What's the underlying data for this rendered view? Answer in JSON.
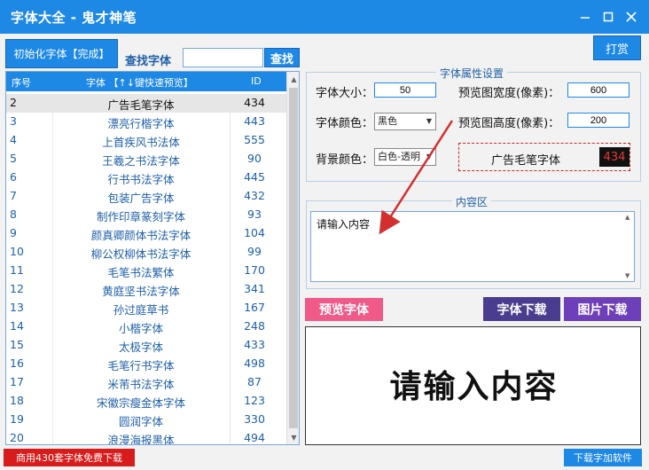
{
  "window": {
    "title": "字体大全 - 鬼才神笔"
  },
  "toolbar": {
    "init_label": "初始化字体【完成】",
    "search_label": "查找字体",
    "search_value": "",
    "search_button": "查找",
    "reward_button": "打赏"
  },
  "font_table": {
    "headers": [
      "序号",
      "字体 【↑↓键快速预览】",
      "ID"
    ],
    "rows": [
      [
        "2",
        "广告毛笔字体",
        "434"
      ],
      [
        "3",
        "漂亮行楷字体",
        "443"
      ],
      [
        "4",
        "上首疾风书法体",
        "555"
      ],
      [
        "5",
        "王羲之书法字体",
        "90"
      ],
      [
        "6",
        "行书书法字体",
        "445"
      ],
      [
        "7",
        "包装广告字体",
        "432"
      ],
      [
        "8",
        "制作印章篆刻字体",
        "93"
      ],
      [
        "9",
        "颜真卿颜体书法字体",
        "104"
      ],
      [
        "10",
        "柳公权柳体书法字体",
        "99"
      ],
      [
        "11",
        "毛笔书法繁体",
        "170"
      ],
      [
        "12",
        "黄庭坚书法字体",
        "341"
      ],
      [
        "13",
        "孙过庭草书",
        "167"
      ],
      [
        "14",
        "小楷字体",
        "248"
      ],
      [
        "15",
        "太极字体",
        "433"
      ],
      [
        "16",
        "毛笔行书字体",
        "498"
      ],
      [
        "17",
        "米芾书法字体",
        "87"
      ],
      [
        "18",
        "宋徽宗瘦金体字体",
        "123"
      ],
      [
        "19",
        "圆润字体",
        "330"
      ],
      [
        "20",
        "浪漫海报黑体",
        "494"
      ]
    ],
    "selected_index": 0
  },
  "properties": {
    "group_title": "字体属性设置",
    "font_size_label": "字体大小：",
    "font_size_value": "50",
    "font_color_label": "字体颜色：",
    "font_color_value": "黑色",
    "bg_color_label": "背景颜色：",
    "bg_color_value": "白色-透明",
    "width_label": "预览图宽度(像素)：",
    "width_value": "600",
    "height_label": "预览图高度(像素)：",
    "height_value": "200",
    "preview_name": "广告毛笔字体",
    "preview_id": "434"
  },
  "content": {
    "group_title": "内容区",
    "text": "请输入内容"
  },
  "actions": {
    "preview_button": "预览字体",
    "font_download_button": "字体下载",
    "image_download_button": "图片下载"
  },
  "preview": {
    "text": "请输入内容"
  },
  "footer": {
    "promo_button": "商用430套字体免费下载",
    "download_button": "下载字加软件"
  },
  "colors": {
    "accent": "#1e88e5",
    "annotation_arrow": "#d32f2f",
    "preview_button": "#ef5a88",
    "font_download": "#4a3d8f",
    "image_download": "#6d3fb8",
    "promo": "#d81b1b"
  }
}
